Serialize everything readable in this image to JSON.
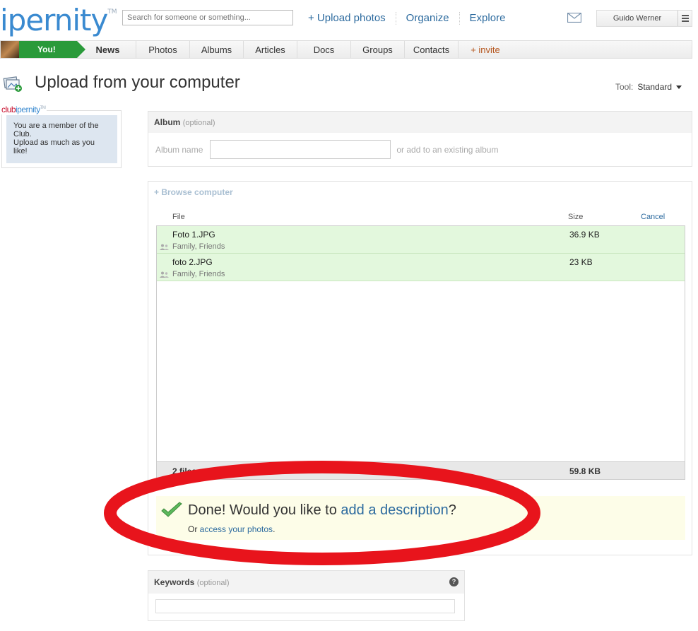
{
  "header": {
    "logo": "ipernity",
    "logo_tm": "TM",
    "search_placeholder": "Search for someone or something...",
    "nav": [
      "+ Upload photos",
      "Organize",
      "Explore"
    ],
    "user_name": "Guido Werner"
  },
  "mainnav": {
    "you": "You!",
    "items": [
      "News",
      "Photos",
      "Albums",
      "Articles",
      "Docs",
      "Groups",
      "Contacts"
    ],
    "invite": "+ invite"
  },
  "page": {
    "title": "Upload from your computer",
    "tool_label": "Tool:",
    "tool_value": "Standard"
  },
  "club": {
    "brand_club": "club",
    "brand_ipernity": "ipernity",
    "brand_tm": "TM",
    "message_line1": "You are a member of the Club.",
    "message_line2": "Upload as much as you like!"
  },
  "album": {
    "header": "Album",
    "optional": "(optional)",
    "name_label": "Album name",
    "existing_link": "or add to an existing album"
  },
  "upload": {
    "browse": "+ Browse computer",
    "col_file": "File",
    "col_size": "Size",
    "cancel": "Cancel",
    "files": [
      {
        "name": "Foto 1.JPG",
        "perm": "Family, Friends",
        "size": "36.9 KB"
      },
      {
        "name": "foto 2.JPG",
        "perm": "Family, Friends",
        "size": "23 KB"
      }
    ],
    "total_files": "2 files",
    "total_size": "59.8 KB"
  },
  "done": {
    "prefix": "Done! Would you like to ",
    "link": "add a description",
    "suffix": "?",
    "sub_prefix": "Or ",
    "sub_link": "access your photos",
    "sub_suffix": "."
  },
  "keywords": {
    "header": "Keywords",
    "optional": "(optional)",
    "help": "?"
  },
  "colors": {
    "accent": "#3a8ad0",
    "link": "#2d6b9f",
    "you_green": "#2a9a3a",
    "file_row": "#e3f8dd",
    "done_bg": "#fdfde8",
    "annotation": "#e8141c"
  }
}
